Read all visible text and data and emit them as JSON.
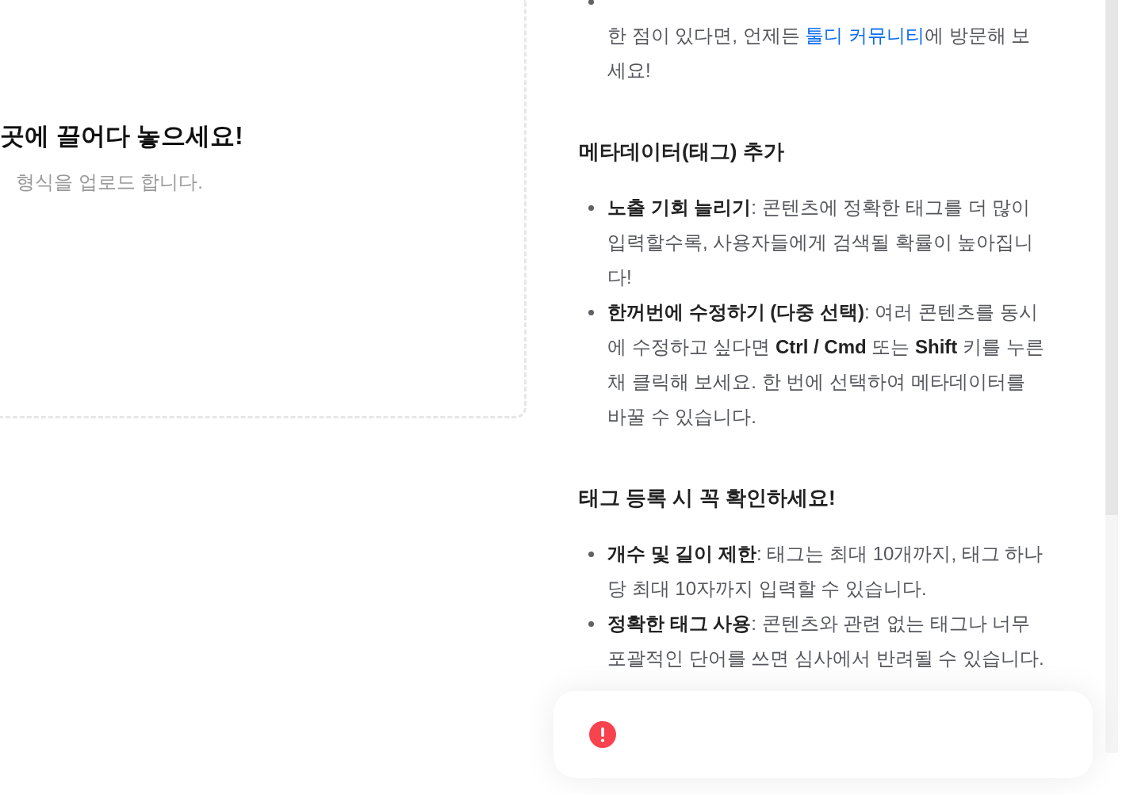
{
  "drop_zone": {
    "title": "곳에 끌어다 놓으세요!",
    "hint": "형식을 업로드 합니다."
  },
  "guide": {
    "sections": [
      {
        "items": [
          {
            "parts": [
              {
                "kind": "text",
                "text": "한 점이 있다면, 언제든 "
              },
              {
                "kind": "link",
                "text": "툴디 커뮤니티"
              },
              {
                "kind": "text",
                "text": "에 방문해 보세요!"
              }
            ]
          }
        ]
      },
      {
        "heading": "메타데이터(태그) 추가",
        "items": [
          {
            "text": "**노출 기회 늘리기**: 콘텐츠에 정확한 태그를 더 많이 입력할수록, 사용자들에게 검색될 확률이 높아집니다!"
          },
          {
            "text": "**한꺼번에 수정하기 (다중 선택)**: 여러 콘텐츠를 동시에 수정하고 싶다면 **Ctrl / Cmd** 또는 **Shift** 키를 누른 채 클릭해 보세요. 한 번에 선택하여 메타데이터를 바꿀 수 있습니다."
          }
        ]
      },
      {
        "heading": "태그 등록 시 꼭 확인하세요!",
        "items": [
          {
            "text": "**개수 및 길이 제한**: 태그는 최대 10개까지, 태그 하나당 최대 10자까지 입력할 수 있습니다."
          },
          {
            "text": "**정확한 태그 사용**: 콘텐츠와 관련 없는 태그나 너무 포괄적인 단어를 쓰면 심사에서 반려될 수 있습니다."
          }
        ]
      }
    ]
  },
  "toast": {
    "kind": "error"
  }
}
